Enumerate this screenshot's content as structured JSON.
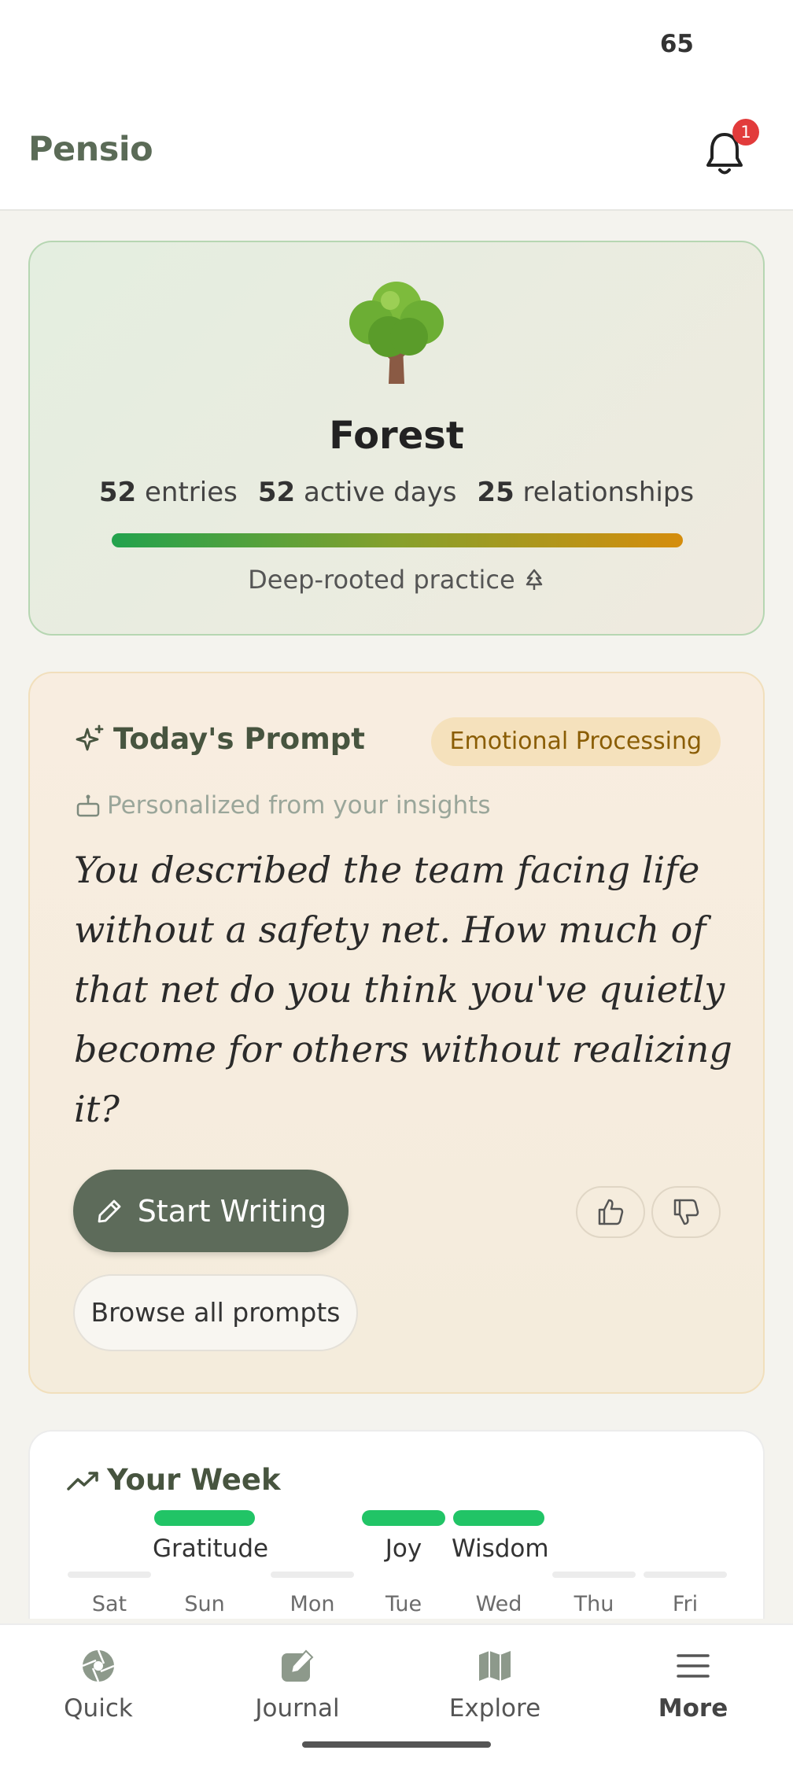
{
  "status_bar": {
    "clock": "65"
  },
  "app_bar": {
    "brand": "Pensio",
    "notification_count": "1"
  },
  "forest_card": {
    "tree_emoji": "🌳",
    "title": "Forest",
    "stats": [
      {
        "value": "52",
        "label": "entries"
      },
      {
        "value": "52",
        "label": "active days"
      },
      {
        "value": "25",
        "label": "relationships"
      }
    ],
    "practice_label": "Deep-rooted practice"
  },
  "prompt_card": {
    "heading": "Today's Prompt",
    "category": "Emotional Processing",
    "personalized_note": "Personalized from your insights",
    "prompt_text": "You described the team facing life without a safety net. How much of that net do you think you've quietly become for others without realizing it?",
    "start_button": "Start Writing",
    "browse_button": "Browse all prompts"
  },
  "week_card": {
    "heading": "Your Week",
    "days": [
      {
        "day": "Sat",
        "tag": "",
        "active": false
      },
      {
        "day": "Sun",
        "tag": "Gratitude",
        "active": true
      },
      {
        "day": "Mon",
        "tag": "",
        "active": false
      },
      {
        "day": "Tue",
        "tag": "Joy",
        "active": true
      },
      {
        "day": "Wed",
        "tag": "Wisdom",
        "active": true
      },
      {
        "day": "Thu",
        "tag": "",
        "active": false
      },
      {
        "day": "Fri",
        "tag": "",
        "active": false
      }
    ]
  },
  "bottom_nav": {
    "items": [
      {
        "label": "Quick",
        "icon": "aperture-icon"
      },
      {
        "label": "Journal",
        "icon": "edit-square-icon"
      },
      {
        "label": "Explore",
        "icon": "map-icon"
      },
      {
        "label": "More",
        "icon": "menu-icon"
      }
    ]
  },
  "colors": {
    "brand": "#5b6b57",
    "accent_green": "#21c466",
    "badge_red": "#e23b3b",
    "prompt_tag_text": "#8a5d05"
  }
}
